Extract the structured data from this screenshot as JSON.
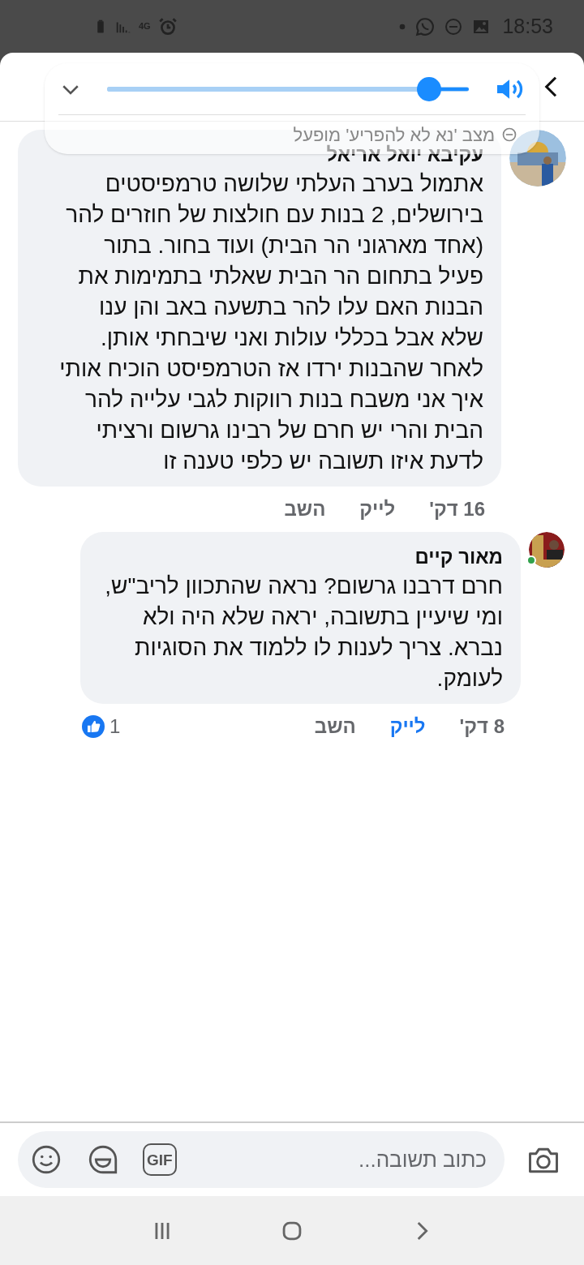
{
  "status_bar": {
    "time": "18:53",
    "network": "4G"
  },
  "volume_popup": {
    "level": 0.89,
    "notice": "מצב 'נא לא להפריע' מופעל"
  },
  "comments": [
    {
      "author": "עקיבא יואל אריאל",
      "online": false,
      "text": "אתמול בערב העלתי שלושה טרמפיסטים בירושלים, 2 בנות עם חולצות של חוזרים להר (אחד מארגוני הר הבית) ועוד בחור. בתור פעיל בתחום הר הבית שאלתי בתמימות את הבנות האם עלו להר בתשעה באב והן ענו שלא אבל בכללי עולות ואני שיבחתי אותן.\nלאחר שהבנות ירדו אז הטרמפיסט הוכיח אותי איך אני משבח בנות רווקות לגבי עלייה להר הבית והרי יש חרם של רבינו גרשום ורציתי לדעת איזו תשובה יש כלפי טענה זו",
      "time": "16 דק'",
      "like_label": "לייק",
      "liked": false,
      "reply_label": "השב"
    },
    {
      "author": "מאור קיים",
      "online": true,
      "text": "חרם דרבנו גרשום? נראה שהתכוון לריב\"ש, ומי שיעיין בתשובה, יראה שלא היה ולא נברא. צריך לענות לו ללמוד את הסוגיות לעומק.",
      "time": "8 דק'",
      "like_label": "לייק",
      "liked": true,
      "reply_label": "השב",
      "reaction_count": "1"
    }
  ],
  "composer": {
    "placeholder": "כתוב תשובה...",
    "gif_label": "GIF"
  }
}
